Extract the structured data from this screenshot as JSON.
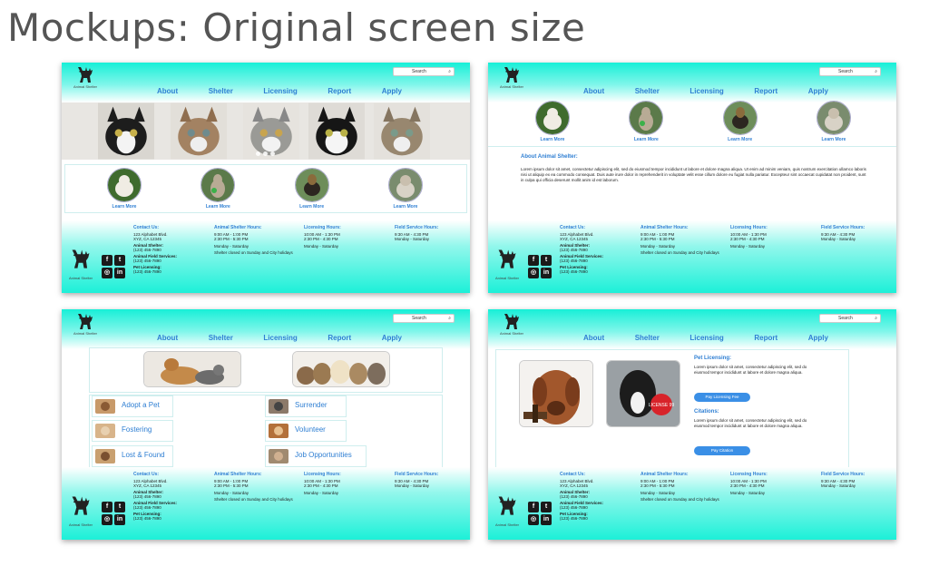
{
  "page_title": "Mockups: Original screen size",
  "header": {
    "search_label": "Search",
    "logo_text": "Animal Shelter",
    "nav": [
      "About",
      "Shelter",
      "Licensing",
      "Report",
      "Apply"
    ]
  },
  "learn_more": "Learn More",
  "footer": {
    "logo_text": "Animal Shelter",
    "social": [
      "f",
      "t",
      "◎",
      "in"
    ],
    "contact": {
      "heading": "Contact Us:",
      "address1": "123 Alphabet Blvd.",
      "address2": "XYZ, CA 12345",
      "shelter_label": "Animal Shelter:",
      "shelter_phone": "(123) 456-7890",
      "field_label": "Animal Field Services:",
      "field_phone": "(123) 456-7890",
      "licensing_label": "Pet Licensing:",
      "licensing_phone": "(123) 456-7890"
    },
    "shelter_hours": {
      "heading": "Animal Shelter Hours:",
      "line1": "9:00 AM - 1:00 PM",
      "line2": "2:30 PM - 5:30 PM",
      "days": "Monday - Saturday",
      "note": "Shelter closed on Sunday and City holidays"
    },
    "licensing_hours": {
      "heading": "Licensing Hours:",
      "line1": "10:00 AM - 1:30 PM",
      "line2": "2:30 PM - 4:30 PM",
      "days": "Monday - Saturday"
    },
    "field_hours": {
      "heading": "Field Service Hours:",
      "line1": "9:30 AM - 4:30 PM",
      "days": "Monday - Saturday"
    }
  },
  "about": {
    "heading": "About Animal Shelter:",
    "text": "Lorem ipsum dolor sit amet, consectetur adipiscing elit, sed do eiusmod tempor incididunt ut labore et dolore magna aliqua. Ut enim ad minim veniam, quis nostrum exercitation ullamco laboris nisi ut aliquip ex ea commodo consequat. Duis aute irure dolor in reprehenderit in voluptate velit esse cillum dolore eu fugiat nulla pariatur. Excepteur sint occaecat cupidatat non proident, sunt in culpa qui officia deserunt mollit anim id est laborum."
  },
  "shelter_options": [
    "Adopt a Pet",
    "Surrender",
    "Fostering",
    "Volunteer",
    "Lost & Found",
    "Job Opportunities"
  ],
  "licensing": {
    "pet_heading": "Pet Licensing:",
    "pet_text": "Lorem ipsum dolor sit amet, consectetur adipiscing elit, sed do eiusmod tempor incididunt ut labore et dolore magna aliqua.",
    "pet_button": "Pay Licensing Fee",
    "cit_heading": "Citations:",
    "cit_text": "Lorem ipsum dolor sit amet, consectetur adipiscing elit, sed do eiusmod tempor incididunt ut labore et dolore magna aliqua.",
    "cit_button": "Pay Citation",
    "tag_text": "LICENSE 99"
  }
}
